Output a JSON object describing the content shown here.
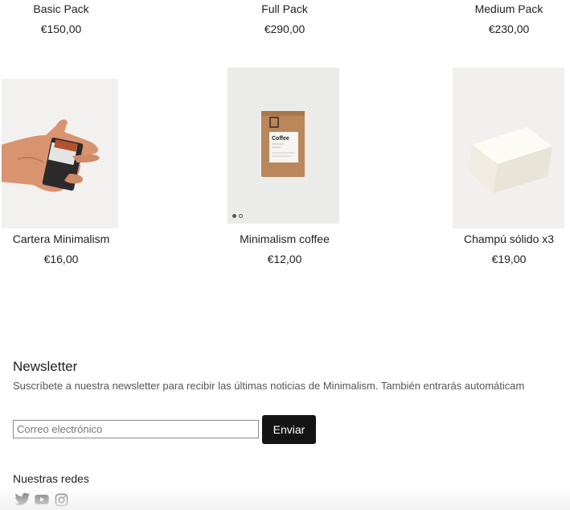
{
  "top_products": [
    {
      "name": "Basic Pack",
      "price": "€150,00"
    },
    {
      "name": "Full Pack",
      "price": "€290,00"
    },
    {
      "name": "Medium Pack",
      "price": "€230,00"
    }
  ],
  "products": [
    {
      "name": "Cartera Minimalism",
      "price": "€16,00"
    },
    {
      "name": "Minimalism coffee",
      "price": "€12,00",
      "bag_label": "Coffee"
    },
    {
      "name": "Champú sólido x3",
      "price": "€19,00"
    }
  ],
  "newsletter": {
    "title": "Newsletter",
    "description": "Suscríbete a nuestra newsletter para recibir las últimas noticias de Minimalism. También entrarás automáticam",
    "email_placeholder": "Correo electrónico",
    "email_value": "",
    "submit_label": "Enviar"
  },
  "social": {
    "title": "Nuestras redes",
    "icons": [
      "twitter-icon",
      "youtube-icon",
      "instagram-icon"
    ]
  },
  "colors": {
    "button_bg": "#141414",
    "image_bg": "#f0efee"
  }
}
